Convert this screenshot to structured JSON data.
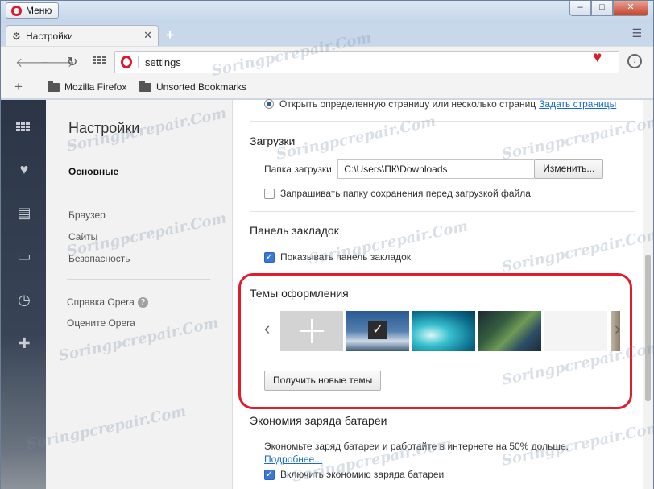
{
  "window": {
    "menu_label": "Меню",
    "controls": [
      "–",
      "□",
      "✕"
    ]
  },
  "tab": {
    "title": "Настройки",
    "icon": "gear-icon"
  },
  "address": {
    "value": "settings"
  },
  "bookmarks": {
    "items": [
      "Mozilla Firefox",
      "Unsorted Bookmarks"
    ]
  },
  "sidebar_icons": [
    "speed-dial-icon",
    "heart-icon",
    "news-icon",
    "sync-icon",
    "history-icon",
    "extensions-icon"
  ],
  "settings_nav": {
    "title": "Настройки",
    "items": [
      "Основные",
      "Браузер",
      "Сайты",
      "Безопасность"
    ],
    "help": "Справка Opera",
    "rate": "Оцените Opera"
  },
  "startup": {
    "option": "Открыть определенную страницу или несколько страниц",
    "link": "Задать страницы"
  },
  "downloads": {
    "title": "Загрузки",
    "folder_label": "Папка загрузки:",
    "folder_value": "C:\\Users\\ПК\\Downloads",
    "change_button": "Изменить...",
    "ask_label": "Запрашивать папку сохранения перед загрузкой файла"
  },
  "bookmarks_panel": {
    "title": "Панель закладок",
    "show_label": "Показывать панель закладок"
  },
  "themes": {
    "title": "Темы оформления",
    "get_button": "Получить новые темы"
  },
  "battery": {
    "title": "Экономия заряда батареи",
    "description": "Экономьте заряд батареи и работайте в интернете на 50% дольше.",
    "more_link": "Подробнее...",
    "enable_label": "Включить экономию заряда батареи"
  },
  "watermark": "Soringpcrepair.Com"
}
